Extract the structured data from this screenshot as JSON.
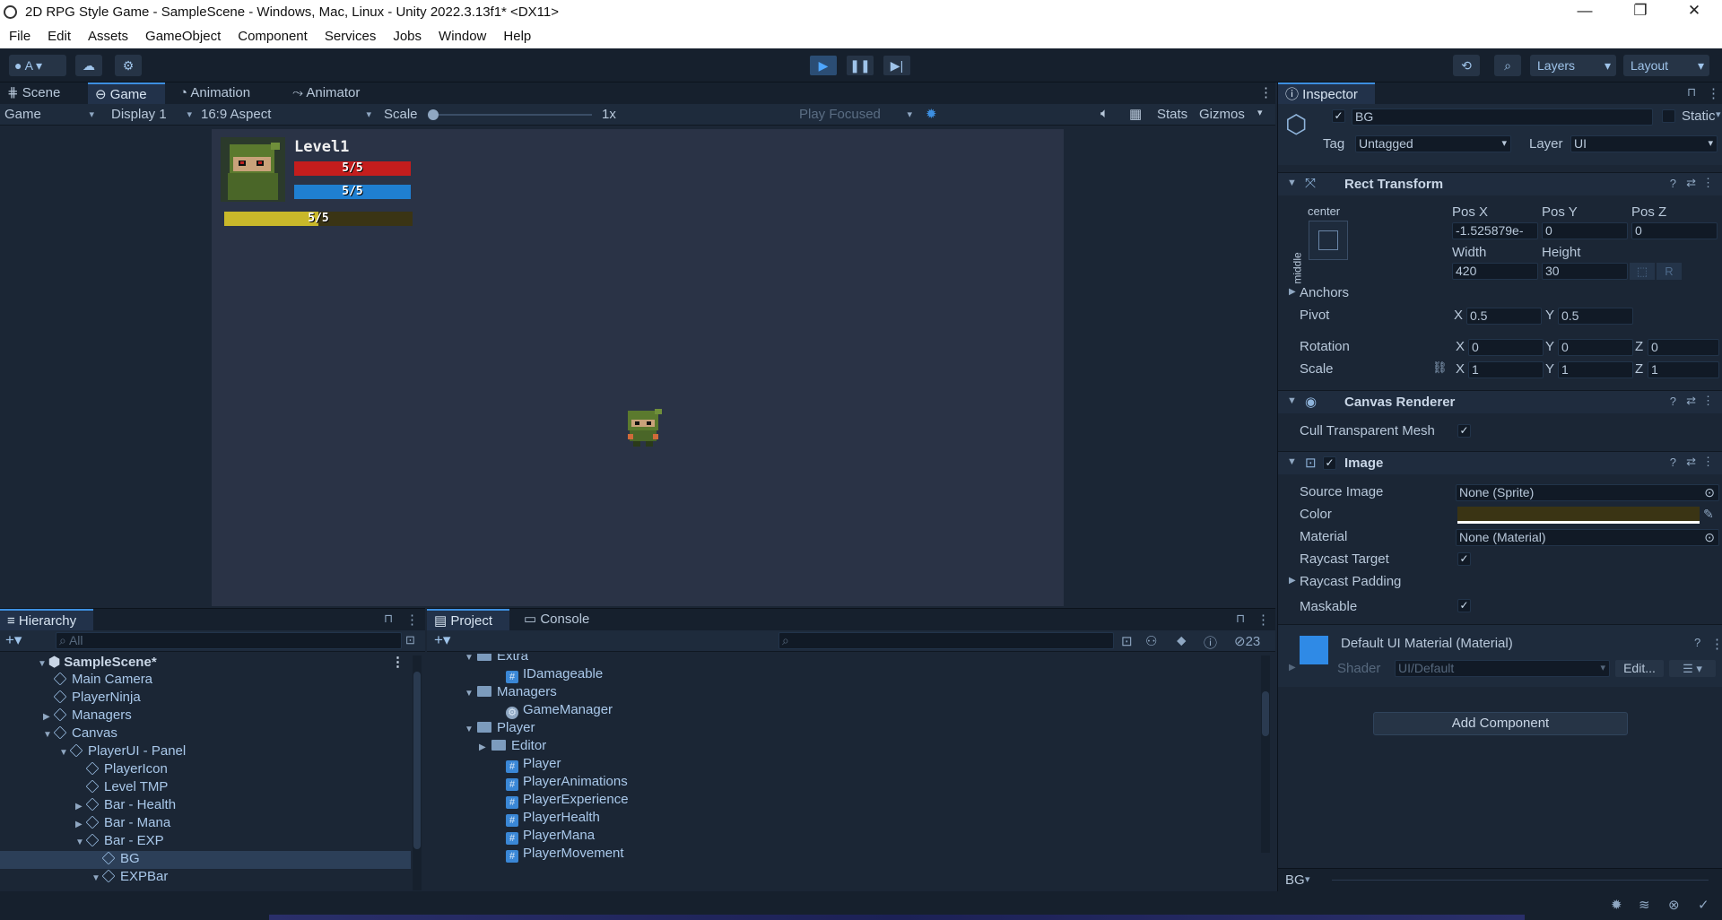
{
  "window": {
    "title": "2D RPG Style Game - SampleScene - Windows, Mac, Linux - Unity 2022.3.13f1* <DX11>",
    "minimize": "—",
    "restore": "❐",
    "close": "✕"
  },
  "menu": [
    "File",
    "Edit",
    "Assets",
    "GameObject",
    "Component",
    "Services",
    "Jobs",
    "Window",
    "Help"
  ],
  "toolbar": {
    "account": "A",
    "layers": "Layers",
    "layout": "Layout"
  },
  "game_panel": {
    "tabs": [
      "Scene",
      "Game",
      "Animation",
      "Animator"
    ],
    "active_tab": "Game",
    "game_dropdown": "Game",
    "display": "Display 1",
    "aspect": "16:9 Aspect",
    "scale_label": "Scale",
    "scale_value": "1x",
    "play_focused": "Play Focused",
    "stats": "Stats",
    "gizmos": "Gizmos",
    "hud": {
      "level": "Level1",
      "health": "5/5",
      "mana": "5/5",
      "exp": "5/5"
    }
  },
  "hierarchy": {
    "title": "Hierarchy",
    "search_placeholder": "All",
    "scene": "SampleScene*",
    "items": [
      {
        "label": "Main Camera",
        "depth": 1,
        "arrow": ""
      },
      {
        "label": "PlayerNinja",
        "depth": 1,
        "arrow": ""
      },
      {
        "label": "Managers",
        "depth": 1,
        "arrow": "▶"
      },
      {
        "label": "Canvas",
        "depth": 1,
        "arrow": "▼"
      },
      {
        "label": "PlayerUI - Panel",
        "depth": 2,
        "arrow": "▼"
      },
      {
        "label": "PlayerIcon",
        "depth": 3,
        "arrow": ""
      },
      {
        "label": "Level TMP",
        "depth": 3,
        "arrow": ""
      },
      {
        "label": "Bar - Health",
        "depth": 3,
        "arrow": "▶"
      },
      {
        "label": "Bar - Mana",
        "depth": 3,
        "arrow": "▶"
      },
      {
        "label": "Bar - EXP",
        "depth": 3,
        "arrow": "▼"
      },
      {
        "label": "BG",
        "depth": 4,
        "arrow": ""
      },
      {
        "label": "EXPBar",
        "depth": 4,
        "arrow": "▼"
      }
    ],
    "selected": "BG"
  },
  "project": {
    "tabs": [
      "Project",
      "Console"
    ],
    "hidden_count": "23",
    "items": [
      {
        "label": "Extra",
        "type": "folder",
        "depth": 0,
        "arrow": "▼"
      },
      {
        "label": "IDamageable",
        "type": "script",
        "depth": 1,
        "arrow": ""
      },
      {
        "label": "Managers",
        "type": "folder",
        "depth": 0,
        "arrow": "▼"
      },
      {
        "label": "GameManager",
        "type": "manager",
        "depth": 1,
        "arrow": ""
      },
      {
        "label": "Player",
        "type": "folder",
        "depth": 0,
        "arrow": "▼"
      },
      {
        "label": "Editor",
        "type": "folder",
        "depth": 1,
        "arrow": "▶"
      },
      {
        "label": "Player",
        "type": "script",
        "depth": 1,
        "arrow": ""
      },
      {
        "label": "PlayerAnimations",
        "type": "script",
        "depth": 1,
        "arrow": ""
      },
      {
        "label": "PlayerExperience",
        "type": "script",
        "depth": 1,
        "arrow": ""
      },
      {
        "label": "PlayerHealth",
        "type": "script",
        "depth": 1,
        "arrow": ""
      },
      {
        "label": "PlayerMana",
        "type": "script",
        "depth": 1,
        "arrow": ""
      },
      {
        "label": "PlayerMovement",
        "type": "script",
        "depth": 1,
        "arrow": ""
      }
    ]
  },
  "inspector": {
    "title": "Inspector",
    "object_name": "BG",
    "static_label": "Static",
    "tag_label": "Tag",
    "tag_value": "Untagged",
    "layer_label": "Layer",
    "layer_value": "UI",
    "rect_transform": {
      "title": "Rect Transform",
      "anchor_h": "center",
      "anchor_v": "middle",
      "pos_x_label": "Pos X",
      "pos_x": "-1.525879e-",
      "pos_y_label": "Pos Y",
      "pos_y": "0",
      "pos_z_label": "Pos Z",
      "pos_z": "0",
      "width_label": "Width",
      "width": "420",
      "height_label": "Height",
      "height": "30",
      "r_button": "R",
      "anchors": "Anchors",
      "pivot": "Pivot",
      "pivot_x": "0.5",
      "pivot_y": "0.5",
      "rotation": "Rotation",
      "rot_x": "0",
      "rot_y": "0",
      "rot_z": "0",
      "scale": "Scale",
      "scale_x": "1",
      "scale_y": "1",
      "scale_z": "1",
      "x": "X",
      "y": "Y",
      "z": "Z"
    },
    "canvas_renderer": {
      "title": "Canvas Renderer",
      "cull": "Cull Transparent Mesh"
    },
    "image": {
      "title": "Image",
      "source_image": "Source Image",
      "source_image_value": "None (Sprite)",
      "color": "Color",
      "color_value": "#3a3414",
      "material": "Material",
      "material_value": "None (Material)",
      "raycast_target": "Raycast Target",
      "raycast_padding": "Raycast Padding",
      "maskable": "Maskable"
    },
    "material_block": {
      "title": "Default UI Material (Material)",
      "shader_label": "Shader",
      "shader_value": "UI/Default",
      "edit": "Edit..."
    },
    "add_component": "Add Component",
    "footer_label": "BG"
  },
  "colors": {
    "accent": "#3d8fe0",
    "health": "#c41d1d",
    "mana": "#1f7fd1",
    "exp": "#c9b82a",
    "game_bg": "#2a3346",
    "editor_bg": "#1b2635"
  }
}
